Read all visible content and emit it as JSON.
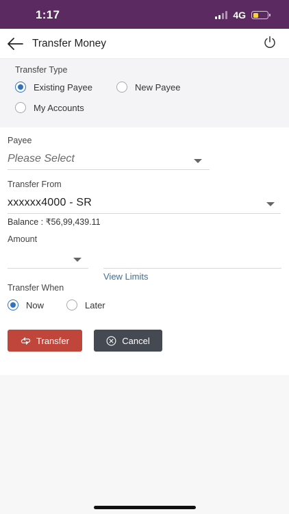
{
  "status_bar": {
    "time": "1:17",
    "network": "4G",
    "battery_level": 0.35,
    "battery_color": "#f5d33b",
    "bg_color": "#5a2a60"
  },
  "header": {
    "title": "Transfer Money",
    "back_icon": "arrow-left-icon",
    "power_icon": "power-icon"
  },
  "transfer_type": {
    "label": "Transfer Type",
    "options": [
      {
        "label": "Existing Payee",
        "checked": true
      },
      {
        "label": "New Payee",
        "checked": false
      },
      {
        "label": "My Accounts",
        "checked": false
      }
    ]
  },
  "payee": {
    "label": "Payee",
    "placeholder": "Please Select"
  },
  "transfer_from": {
    "label": "Transfer From",
    "value": "xxxxxx4000 - SR",
    "balance_label": "Balance :",
    "balance_value": "₹56,99,439.11"
  },
  "amount": {
    "label": "Amount",
    "view_limits": "View Limits"
  },
  "transfer_when": {
    "label": "Transfer When",
    "options": [
      {
        "label": "Now",
        "checked": true
      },
      {
        "label": "Later",
        "checked": false
      }
    ]
  },
  "buttons": {
    "transfer": "Transfer",
    "cancel": "Cancel",
    "transfer_color": "#c0453a",
    "cancel_color": "#454a52"
  },
  "accent_color": "#2e72c0"
}
